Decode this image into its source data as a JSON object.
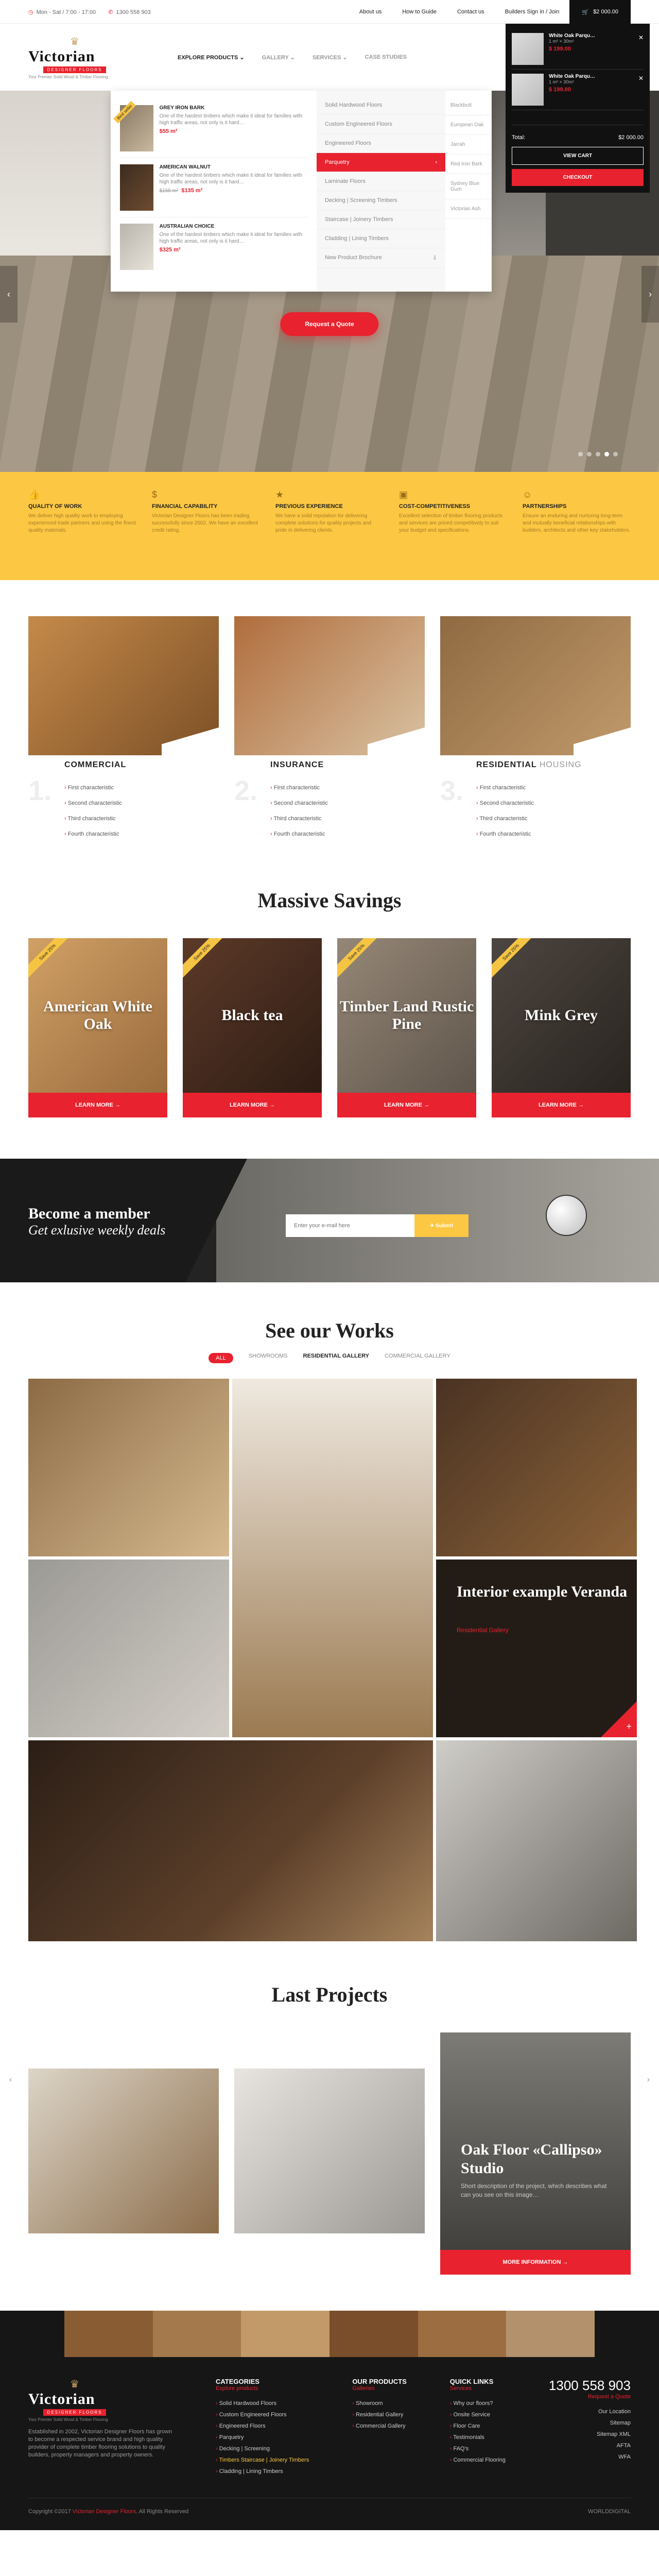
{
  "topbar": {
    "hours": "Mon - Sat / 7:00 - 17:00",
    "phone": "1300 558 903",
    "links": [
      "About us",
      "How to Guide",
      "Contact us",
      "Builders Sign in / Join"
    ],
    "cart_total": "$2 000.00"
  },
  "logo": {
    "name": "Victorian",
    "ribbon": "DESIGNER FLOORS",
    "tagline": "Your Premier Solid Wood & Timber Flooring"
  },
  "nav": [
    "Explore Products",
    "Gallery",
    "Services",
    "Case Studies"
  ],
  "mega": {
    "products": [
      {
        "name": "Grey Iron Bark",
        "desc": "One of the hardest timbers which make it ideal for families with high traffic areas, not only is it hard…",
        "price": "$55 m²",
        "old": "",
        "tag": "Best seller"
      },
      {
        "name": "American Walnut",
        "desc": "One of the hardest timbers which make it ideal for families with high traffic areas, not only is it hard…",
        "price": "$135 m²",
        "old": "$155 m²",
        "tag": ""
      },
      {
        "name": "Australian Choice",
        "desc": "One of the hardest timbers which make it ideal for families with high traffic areas, not only is it hard…",
        "price": "$325 m²",
        "old": "",
        "tag": ""
      }
    ],
    "categories": [
      "Solid Hardwood Floors",
      "Custom Engineered Floors",
      "Engineered Floors",
      "Parquetry",
      "Laminate Floors",
      "Decking | Screening Timbers",
      "Staircase | Joinery Timbers",
      "Cladding | Lining Timbers",
      "New Product Brochure"
    ],
    "active_category": 3,
    "sub": [
      "Blackbutt",
      "European Oak",
      "Jarrah",
      "Red Iron Bark",
      "Sydney Blue Gum",
      "Victorian Ash"
    ],
    "sub2": [
      "Jarrah",
      "Red Iron Bark",
      "Sydney Blue Gum",
      "Victorian Ash"
    ]
  },
  "cart": {
    "items": [
      {
        "name": "White Oak Parqu…",
        "meta": "1 m² × 30m²",
        "price": "$ 199.00"
      },
      {
        "name": "White Oak Parqu…",
        "meta": "1 m² × 30m²",
        "price": "$ 199.00"
      }
    ],
    "total_label": "Total:",
    "total": "$2 000.00",
    "view_cart": "View Cart",
    "checkout": "Checkout"
  },
  "hero": {
    "cta": "Request a Quote"
  },
  "benefits": [
    {
      "title": "Quality of Work",
      "text": "We deliver high quality work to employing experienced trade partners and using the finest quality materials."
    },
    {
      "title": "Financial Capability",
      "text": "Victorian Designer Floors has been trading successfully since 2002. We have an excellent credit rating."
    },
    {
      "title": "Previous Experience",
      "text": "We have a solid reputation for delivering complete solutions for quality projects and pride in delivering clients."
    },
    {
      "title": "Cost-Competitiveness",
      "text": "Excellent selection of timber flooring products and services are priced competitively to suit your budget and specifications."
    },
    {
      "title": "Partnerships",
      "text": "Ensure an enduring and nurturing long-term and mutually beneficial relationships with builders, architects and other key stakeholders."
    }
  ],
  "services": [
    {
      "num": "1.",
      "title": "Commercial",
      "title_light": "",
      "items": [
        "First characteristic",
        "Second characteristic",
        "Third characteristic",
        "Fourth characteristic"
      ]
    },
    {
      "num": "2.",
      "title": "Insurance",
      "title_light": "",
      "items": [
        "First characteristic",
        "Second characteristic",
        "Third characteristic",
        "Fourth characteristic"
      ]
    },
    {
      "num": "3.",
      "title": "Residential",
      "title_light": "Housing",
      "items": [
        "First characteristic",
        "Second characteristic",
        "Third characteristic",
        "Fourth characteristic"
      ]
    }
  ],
  "savings": {
    "title": "Massive Savings",
    "items": [
      {
        "name": "American White Oak",
        "badge": "Save 25%",
        "bg": "#b58550"
      },
      {
        "name": "Black tea",
        "badge": "Save 25%",
        "bg": "#4a2f22"
      },
      {
        "name": "Timber Land Rustic Pine",
        "badge": "Save 25%",
        "bg": "#7d7268"
      },
      {
        "name": "Mink Grey",
        "badge": "Save 25%",
        "bg": "#3b3632"
      }
    ],
    "button": "Learn more →"
  },
  "member": {
    "title": "Become a member",
    "subtitle": "Get exlusive weekly deals",
    "placeholder": "Enter your e-mail here",
    "button": "Submit"
  },
  "works": {
    "title": "See our Works",
    "filters": [
      "All",
      "Showrooms",
      "Residential Gallery",
      "Commercial Gallery"
    ],
    "feature_title": "Interior example Veranda",
    "feature_sub": "Residential Gallery"
  },
  "projects": {
    "title": "Last Projects",
    "feature_title": "Oak Floor «Callipso» Studio",
    "feature_text": "Short description of the project, which describes what can you see on this image…",
    "button": "More information →"
  },
  "footer": {
    "about": "Established in 2002, Victorian Designer Floors has grown to become a respected service brand and high quality provider of complete timber flooring solutions to quality builders, property managers and property owners.",
    "categories": {
      "title": "Categories",
      "sub": "Explore products",
      "items": [
        "Solid Hardwood Floors",
        "Custom Engineered Floors",
        "Engineered Floors",
        "Parquetry",
        "Decking | Screening",
        "Timbers Staircase | Joinery Timbers",
        "Cladding | Lining Timbers"
      ]
    },
    "products": {
      "title": "Our Products",
      "sub": "Galleries",
      "items": [
        "Showroom",
        "Residential Gallery",
        "Commercial Gallery"
      ]
    },
    "quick": {
      "title": "Quick Links",
      "sub": "Services",
      "items": [
        "Why our floors?",
        "Onsite Service",
        "Floor Care",
        "Testimonials",
        "FAQ's",
        "Commercial Flooring"
      ]
    },
    "contact": {
      "phone": "1300 558 903",
      "sub": "Request a Quote",
      "items": [
        "Our Location",
        "Sitemap",
        "Sitemap XML",
        "AFTA",
        "WFA"
      ]
    },
    "copyright": "Copyright ©2017",
    "copyright_red": "Victorian Designer Floors",
    "copyright_end": ". All Rights Reserved",
    "credit": "WORLDDIGITAL"
  }
}
